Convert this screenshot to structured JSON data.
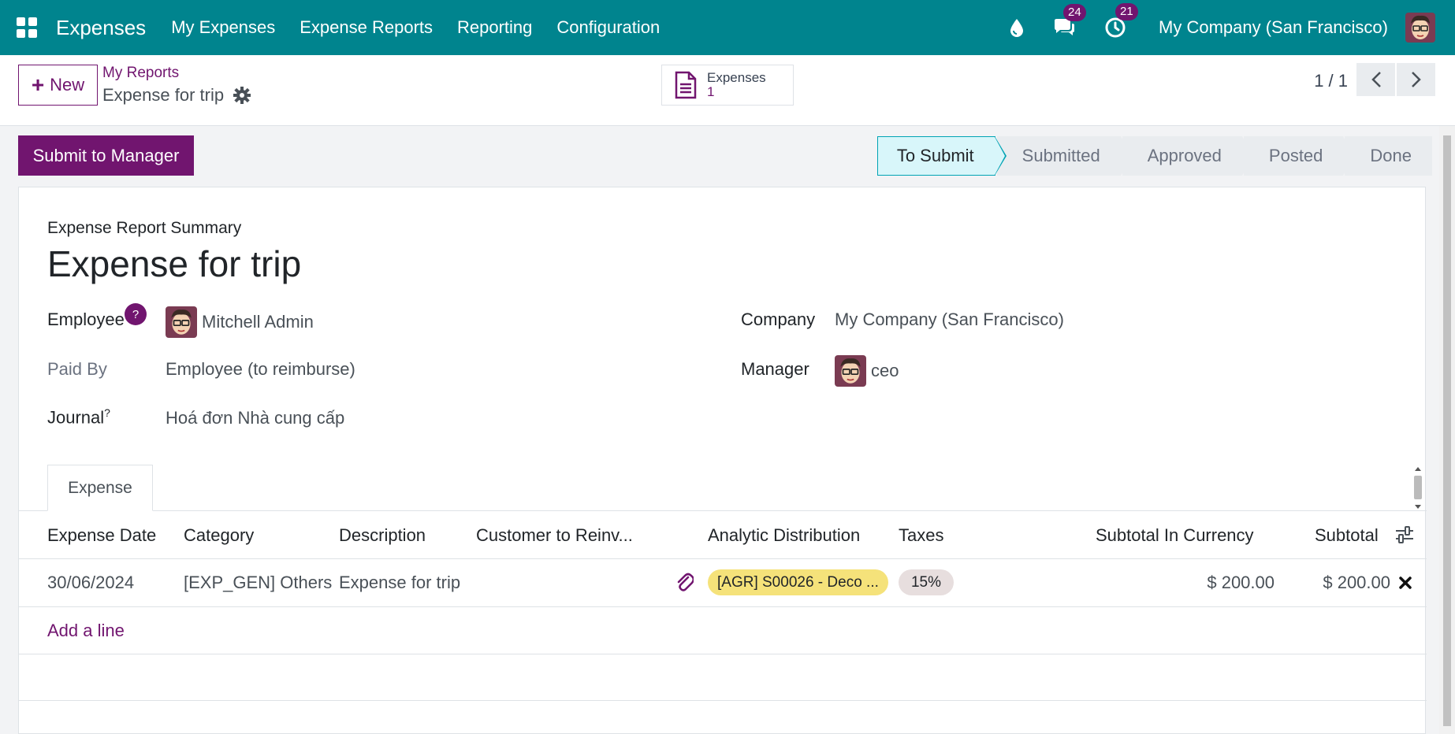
{
  "navbar": {
    "app_name": "Expenses",
    "menu": [
      "My Expenses",
      "Expense Reports",
      "Reporting",
      "Configuration"
    ],
    "messages_count": "24",
    "activities_count": "21",
    "company": "My Company (San Francisco)"
  },
  "control_panel": {
    "new_label": "New",
    "breadcrumb_parent": "My Reports",
    "breadcrumb_current": "Expense for trip",
    "smart_button": {
      "label": "Expenses",
      "value": "1"
    },
    "pager": "1 / 1"
  },
  "actions": {
    "submit_label": "Submit to Manager",
    "stages": [
      "To Submit",
      "Submitted",
      "Approved",
      "Posted",
      "Done"
    ],
    "active_stage": "To Submit"
  },
  "form": {
    "summary_label": "Expense Report Summary",
    "title": "Expense for trip",
    "employee_label": "Employee",
    "help_mark": "?",
    "employee": "Mitchell Admin",
    "paid_by_label": "Paid By",
    "paid_by": "Employee (to reimburse)",
    "journal_label": "Journal",
    "journal_sup": "?",
    "journal": "Hoá đơn Nhà cung cấp",
    "company_label": "Company",
    "company": "My Company (San Francisco)",
    "manager_label": "Manager",
    "manager": "ceo"
  },
  "tab": {
    "label": "Expense"
  },
  "table": {
    "columns": [
      "Expense Date",
      "Category",
      "Description",
      "Customer to Reinv...",
      "Analytic Distribution",
      "Taxes",
      "Subtotal In Currency",
      "Subtotal"
    ],
    "rows": [
      {
        "date": "30/06/2024",
        "category": "[EXP_GEN] Others",
        "description": "Expense for trip",
        "customer": "",
        "analytic": "[AGR] S00026 - Deco ...",
        "taxes": "15%",
        "subtotal_currency": "$ 200.00",
        "subtotal": "$ 200.00"
      }
    ],
    "add_line_label": "Add a line"
  },
  "colors": {
    "brand": "#00848e",
    "accent": "#71156f",
    "active_stage": "#d8f6fa"
  }
}
